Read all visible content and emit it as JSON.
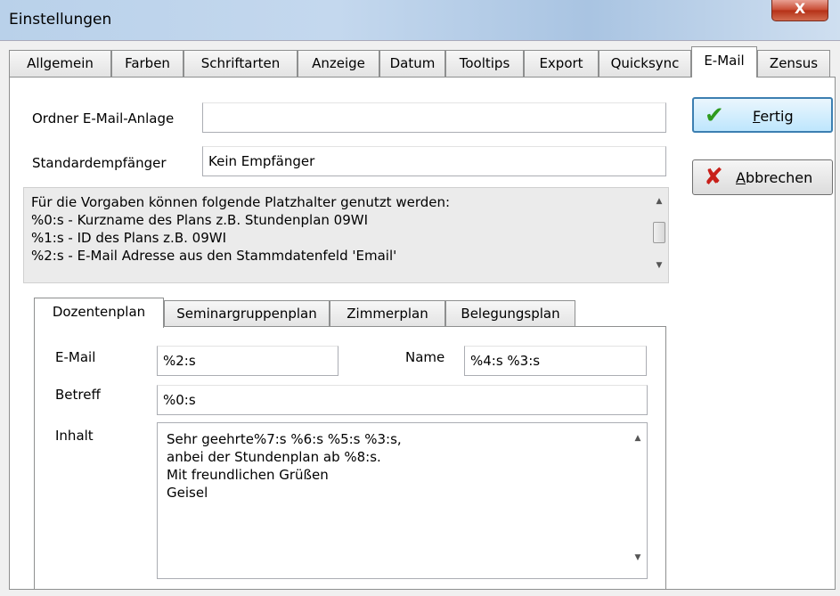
{
  "window": {
    "title": "Einstellungen",
    "close_glyph": "X"
  },
  "tabs": [
    "Allgemein",
    "Farben",
    "Schriftarten",
    "Anzeige",
    "Datum",
    "Tooltips",
    "Export",
    "Quicksync",
    "E-Mail",
    "Zensus"
  ],
  "active_tab": "E-Mail",
  "fields": {
    "ordner_label": "Ordner E-Mail-Anlage",
    "ordner_value": "",
    "standard_label": "Standardempfänger",
    "standard_value": "Kein Empfänger"
  },
  "info": {
    "lines": [
      "Für die Vorgaben können folgende Platzhalter genutzt werden:",
      "%0:s - Kurzname des Plans z.B. Stundenplan 09WI",
      "%1:s - ID des Plans z.B. 09WI",
      "%2:s - E-Mail Adresse aus den Stammdatenfeld 'Email'"
    ]
  },
  "subtabs": [
    "Dozentenplan",
    "Seminargruppenplan",
    "Zimmerplan",
    "Belegungsplan"
  ],
  "active_subtab": "Dozentenplan",
  "form": {
    "email_label": "E-Mail",
    "email_value": "%2:s",
    "name_label": "Name",
    "name_value": "%4:s %3:s",
    "betreff_label": "Betreff",
    "betreff_value": "%0:s",
    "inhalt_label": "Inhalt",
    "inhalt_lines": [
      "Sehr geehrte%7:s %6:s %5:s %3:s,",
      "anbei der Stundenplan ab %8:s.",
      "Mit freundlichen Grüßen",
      "Geisel"
    ]
  },
  "buttons": {
    "fertig_hotkey": "F",
    "fertig_rest": "ertig",
    "fertig_icon": "check-icon",
    "abbrechen_hotkey": "A",
    "abbrechen_rest": "bbrechen",
    "abbrechen_icon": "cross-icon"
  },
  "colors": {
    "check": "#2e9a1e",
    "cross": "#c8201a",
    "default_border": "#3c7fb1"
  }
}
